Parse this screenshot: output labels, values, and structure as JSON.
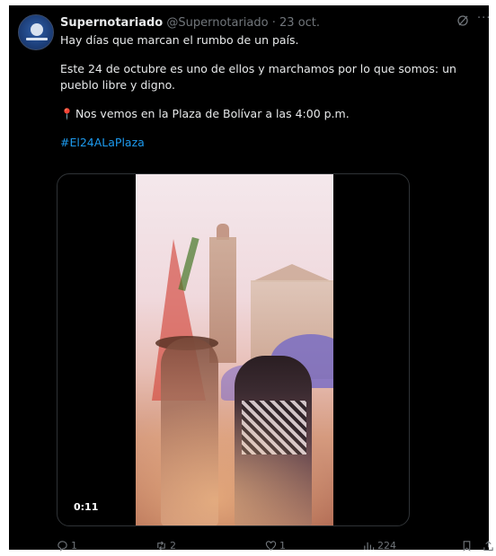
{
  "tweet": {
    "author_name": "Supernotariado",
    "handle": "@Supernotariado",
    "separator": "·",
    "date": "23 oct.",
    "more_label": "···",
    "lines": [
      "Hay días que marcan el rumbo de un país.",
      "Este 24 de octubre es uno de ellos y marchamos por lo que somos: un pueblo libre y digno.",
      "Nos vemos en la Plaza de Bolívar a las 4:00 p.m."
    ],
    "hashtag": "#El24ALaPlaza",
    "pin_icon": "round-pushpin-icon"
  },
  "media": {
    "duration": "0:11"
  },
  "actions": {
    "replies": "1",
    "retweets": "2",
    "likes": "1",
    "views": "224"
  },
  "colors": {
    "background": "#000000",
    "text": "#e7e9ea",
    "muted": "#71767b",
    "link": "#1d9bf0"
  }
}
